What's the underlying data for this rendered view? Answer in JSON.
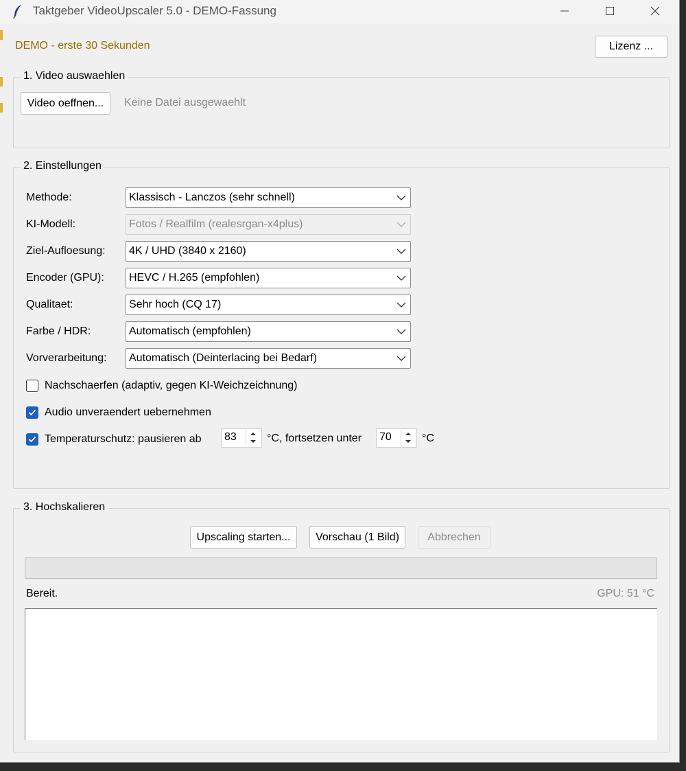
{
  "window": {
    "title": "Taktgeber VideoUpscaler 5.0 - DEMO-Fassung",
    "icon": "feather-icon"
  },
  "top": {
    "demo_label": "DEMO - erste 30 Sekunden",
    "license_button": "Lizenz ..."
  },
  "section_video": {
    "legend": "1. Video auswaehlen",
    "open_button": "Video oeffnen...",
    "file_status": "Keine Datei ausgewaehlt"
  },
  "section_settings": {
    "legend": "2. Einstellungen",
    "rows": [
      {
        "label": "Methode:",
        "value": "Klassisch - Lanczos (sehr schnell)",
        "enabled": true
      },
      {
        "label": "KI-Modell:",
        "value": "Fotos / Realfilm (realesrgan-x4plus)",
        "enabled": false
      },
      {
        "label": "Ziel-Aufloesung:",
        "value": "4K / UHD (3840 x 2160)",
        "enabled": true
      },
      {
        "label": "Encoder (GPU):",
        "value": "HEVC / H.265 (empfohlen)",
        "enabled": true
      },
      {
        "label": "Qualitaet:",
        "value": "Sehr hoch (CQ 17)",
        "enabled": true
      },
      {
        "label": "Farbe / HDR:",
        "value": "Automatisch (empfohlen)",
        "enabled": true
      },
      {
        "label": "Vorverarbeitung:",
        "value": "Automatisch (Deinterlacing bei Bedarf)",
        "enabled": true
      }
    ],
    "sharpen": {
      "label": "Nachschaerfen (adaptiv, gegen KI-Weichzeichnung)",
      "checked": false
    },
    "audio": {
      "label": "Audio unveraendert uebernehmen",
      "checked": true
    },
    "temperature": {
      "checked": true,
      "label_prefix": "Temperaturschutz: pausieren ab",
      "pause_value": "83",
      "label_middle": "°C, fortsetzen unter",
      "resume_value": "70",
      "label_suffix": "°C"
    }
  },
  "section_upscale": {
    "legend": "3. Hochskalieren",
    "start_button": "Upscaling starten...",
    "preview_button": "Vorschau (1 Bild)",
    "cancel_button": "Abbrechen",
    "progress": 0,
    "status": "Bereit.",
    "gpu_temp": "GPU: 51 °C",
    "log": ""
  },
  "colors": {
    "demo_label": "#9a6b00",
    "checkbox_checked": "#1f5fbf",
    "window_bg": "#f0f0f0"
  }
}
